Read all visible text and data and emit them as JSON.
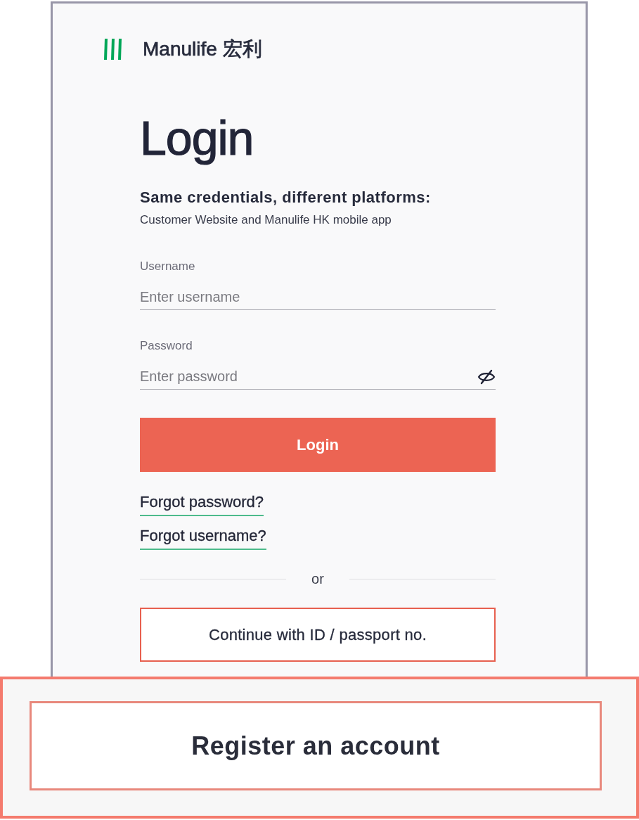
{
  "logo": {
    "wordmark": "Manulife 宏利"
  },
  "title": "Login",
  "intro": {
    "heading": "Same credentials, different platforms:",
    "text": "Customer Website and Manulife HK mobile app"
  },
  "fields": [
    {
      "kind": "text",
      "label": "Username",
      "placeholder": "Enter username"
    },
    {
      "kind": "password",
      "label": "Password",
      "placeholder": "Enter password"
    }
  ],
  "login_button": "Login",
  "links": [
    "Forgot password?",
    "Forgot username?"
  ],
  "divider": "or",
  "id_button": "Continue with ID / passport no.",
  "highlight": {
    "register_button": "Register an account"
  }
}
